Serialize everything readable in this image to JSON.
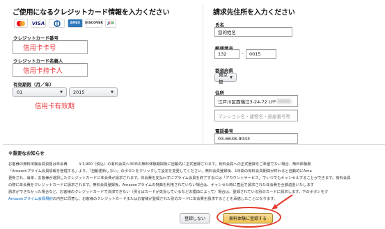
{
  "left": {
    "heading": "ご使用になるクレジットカード情報を入力ください",
    "cards": [
      {
        "name": "mastercard-icon",
        "label": "MasterCard",
        "bg": "#ffffff",
        "fg": "#d9222a"
      },
      {
        "name": "visa-icon",
        "label": "VISA",
        "bg": "#ffffff",
        "fg": "#1a1f71"
      },
      {
        "name": "diners-icon",
        "label": "Diners Club",
        "bg": "#ffffff",
        "fg": "#004a97"
      },
      {
        "name": "amex-icon",
        "label": "AMEX",
        "bg": "#2e77bc",
        "fg": "#ffffff"
      },
      {
        "name": "discover-icon",
        "label": "DISCOVER",
        "bg": "#ffffff",
        "fg": "#222222"
      },
      {
        "name": "jcb-icon",
        "label": "JCB",
        "bg": "#ffffff",
        "fg": "#0e4c96"
      }
    ],
    "card_number_label": "クレジットカード番号",
    "card_number_note": "信用卡卡号",
    "card_name_label": "クレジットカード名義人",
    "card_name_note": "信用卡持卡人",
    "expiry_label": "有効期限（月／年）",
    "expiry_month": "01",
    "expiry_year": "2015",
    "expiry_note": "信用卡有效期"
  },
  "right": {
    "heading": "請求先住所を入力ください",
    "name_label": "氏名",
    "name_value": "您的姓名",
    "zip_label": "郵便番号",
    "zip_first": "132",
    "zip_sep": "-",
    "zip_second": "0015",
    "prefecture_label": "都道府県",
    "prefecture_value": "東京都",
    "address_label": "住所",
    "address_value": "江戸川区西瑞江3-24-72 LYF",
    "address2_placeholder": "マンション名・建物名・部屋番号等",
    "phone_label": "電話番号",
    "phone_value": "03-6638-9043"
  },
  "notice": {
    "title": "※重要なお知らせ",
    "lines": [
      "お客様の無料体験会員資格は年会費　　　￥3,900（税込）の有料会員へ30日の無料体験期間後に自動的に正式登録されます。有料会員への正式登録をご希望でない場合、無料体験期",
      "「Amazonプライム会員情報を管理する」より、「自動更新しない」のボタンをクリックして設定を変更してください。無料会員登録後、1年間の有料会員期間が終わると自動的にAma",
      "更新され、毎年、お客様が選択したクレジットカードに年会費が請求されます。年会費を支払わずにプライム会員を終了するには「アカウントサービス」でいつでもキャンセルすることができます。有料会員",
      "の際に年会費をクレジットカードに請求されます。無料会員登録後、Amazonプライムの特典を利用されていない場合は、キャンセル時に直近で請求された年会費を全額返金いたします",
      "請求ができなかった場合など、お客様のクレジットカードで決済できない（例えばカードが失効しているなどの理由によって）場合は、登録されている別のカードに請求します。下のボタンをク",
      "Amazonプライム会員規約の内容に同意し、お客様のクレジットカードまたはお客様が登録された別のカードに年会費を請求することを承諾したことになります。"
    ],
    "link_text": "Amazonプライム会員規約",
    "cancel_label": "登録しない",
    "primary_label": "無料体験に登録する"
  },
  "colors": {
    "annotation_red": "#e8343a",
    "primary_button": "#f0c14b",
    "link": "#0066c0"
  }
}
